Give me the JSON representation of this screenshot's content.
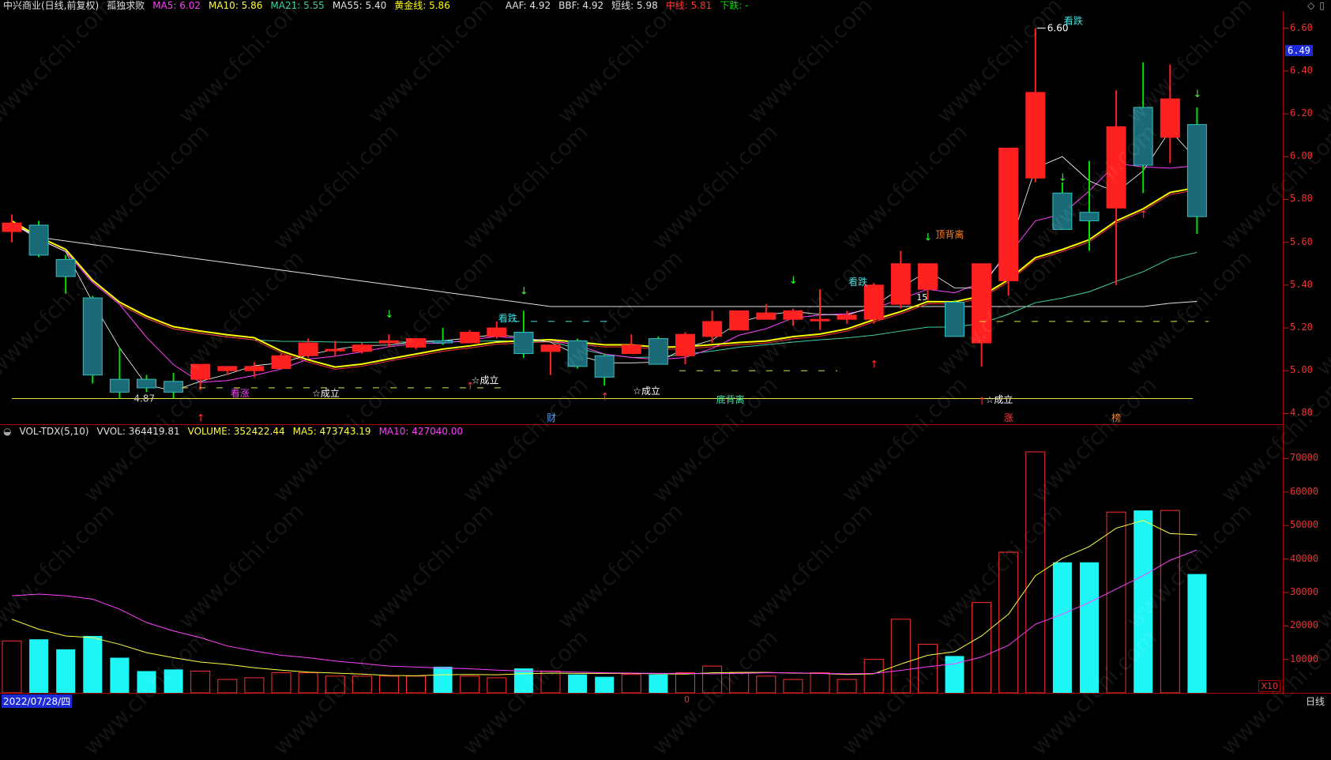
{
  "header": {
    "stock": "中兴商业(日线,前复权)",
    "strategy": "孤独求败",
    "items": [
      {
        "text": "MA5: 6.02",
        "color": "#ff40ff"
      },
      {
        "text": "MA10: 5.86",
        "color": "#ffff40"
      },
      {
        "text": "MA21: 5.55",
        "color": "#40d0a0"
      },
      {
        "text": "MA55: 5.40",
        "color": "#e0e0e0"
      },
      {
        "text": "黄金线: 5.86",
        "color": "#ffff00"
      },
      {
        "text": "AAF: 4.92",
        "color": "#e0e0e0"
      },
      {
        "text": "BBF: 4.92",
        "color": "#e0e0e0"
      },
      {
        "text": "短线: 5.98",
        "color": "#e0e0e0"
      },
      {
        "text": "中线: 5.81",
        "color": "#ff3030"
      },
      {
        "text": "下跌: -",
        "color": "#00e000"
      }
    ]
  },
  "corner_icons": [
    "diamond-icon",
    "window-icon"
  ],
  "price_axis": {
    "ticks": [
      "6.60",
      "6.40",
      "6.20",
      "6.00",
      "5.80",
      "5.60",
      "5.40",
      "5.20",
      "5.00",
      "4.80"
    ],
    "last_price": "6.49"
  },
  "vol_header": {
    "indicator": "VOL-TDX(5,10)",
    "vvol": "VVOL: 364419.81",
    "volume": "VOLUME: 352422.44",
    "ma5": "MA5: 473743.19",
    "ma10": "MA10: 427040.00"
  },
  "vol_axis": {
    "ticks": [
      "70000",
      "60000",
      "50000",
      "40000",
      "30000",
      "20000",
      "10000"
    ],
    "multiplier": "X10"
  },
  "annotations": {
    "high_label": "6.60",
    "low_label": "4.87",
    "kandie_1": "看跌",
    "kandie_2": "看跌",
    "kandie_3": "看跌",
    "kanzhang": "看涨",
    "chengli_1": "☆成立",
    "chengli_2": "☆成立",
    "chengli_3": "☆成立",
    "chengli_4": "☆成立",
    "dingbeili": "顶背离",
    "dibeili": "底背离",
    "cai": "财",
    "zhang": "涨",
    "bang": "榜",
    "mid_15": "15"
  },
  "footer": {
    "date": "2022/07/28/四",
    "period": "日线",
    "marker": "0"
  },
  "colors": {
    "up": "#ff2020",
    "down": "#00e000",
    "cyan": "#1ef5f5",
    "ma5": "#ff40ff",
    "ma10": "#ffff40",
    "ma21": "#40d0a0",
    "ma55": "#e0e0e0",
    "gold": "#ffff00",
    "teal_fill": "#1a6a78"
  },
  "watermark": "www.cfchi.com",
  "chart_data": {
    "type": "candlestick",
    "price_range": [
      4.75,
      6.68
    ],
    "candles": [
      {
        "o": 5.65,
        "h": 5.73,
        "l": 5.6,
        "c": 5.69
      },
      {
        "o": 5.68,
        "h": 5.7,
        "l": 5.53,
        "c": 5.54
      },
      {
        "o": 5.52,
        "h": 5.54,
        "l": 5.36,
        "c": 5.44
      },
      {
        "o": 5.34,
        "h": 5.35,
        "l": 4.94,
        "c": 4.98
      },
      {
        "o": 4.96,
        "h": 5.11,
        "l": 4.87,
        "c": 4.9
      },
      {
        "o": 4.96,
        "h": 4.98,
        "l": 4.9,
        "c": 4.92
      },
      {
        "o": 4.95,
        "h": 4.99,
        "l": 4.87,
        "c": 4.9
      },
      {
        "o": 4.96,
        "h": 5.03,
        "l": 4.91,
        "c": 5.03
      },
      {
        "o": 5.0,
        "h": 5.02,
        "l": 4.98,
        "c": 5.02
      },
      {
        "o": 5.0,
        "h": 5.04,
        "l": 4.97,
        "c": 5.02
      },
      {
        "o": 5.01,
        "h": 5.08,
        "l": 5.01,
        "c": 5.07
      },
      {
        "o": 5.07,
        "h": 5.15,
        "l": 5.06,
        "c": 5.13
      },
      {
        "o": 5.1,
        "h": 5.14,
        "l": 5.07,
        "c": 5.1
      },
      {
        "o": 5.09,
        "h": 5.13,
        "l": 5.08,
        "c": 5.12
      },
      {
        "o": 5.13,
        "h": 5.17,
        "l": 5.11,
        "c": 5.14
      },
      {
        "o": 5.11,
        "h": 5.15,
        "l": 5.1,
        "c": 5.15
      },
      {
        "o": 5.14,
        "h": 5.2,
        "l": 5.12,
        "c": 5.13
      },
      {
        "o": 5.13,
        "h": 5.19,
        "l": 5.13,
        "c": 5.18
      },
      {
        "o": 5.16,
        "h": 5.23,
        "l": 5.15,
        "c": 5.2
      },
      {
        "o": 5.18,
        "h": 5.28,
        "l": 5.06,
        "c": 5.08
      },
      {
        "o": 5.09,
        "h": 5.12,
        "l": 4.98,
        "c": 5.12
      },
      {
        "o": 5.14,
        "h": 5.15,
        "l": 5.01,
        "c": 5.02
      },
      {
        "o": 5.07,
        "h": 5.08,
        "l": 4.93,
        "c": 4.97
      },
      {
        "o": 5.08,
        "h": 5.17,
        "l": 5.08,
        "c": 5.12
      },
      {
        "o": 5.15,
        "h": 5.16,
        "l": 5.03,
        "c": 5.03
      },
      {
        "o": 5.07,
        "h": 5.18,
        "l": 5.03,
        "c": 5.17
      },
      {
        "o": 5.16,
        "h": 5.28,
        "l": 5.13,
        "c": 5.23
      },
      {
        "o": 5.19,
        "h": 5.28,
        "l": 5.19,
        "c": 5.28
      },
      {
        "o": 5.24,
        "h": 5.31,
        "l": 5.24,
        "c": 5.27
      },
      {
        "o": 5.24,
        "h": 5.29,
        "l": 5.21,
        "c": 5.28
      },
      {
        "o": 5.24,
        "h": 5.38,
        "l": 5.19,
        "c": 5.24
      },
      {
        "o": 5.24,
        "h": 5.28,
        "l": 5.22,
        "c": 5.26
      },
      {
        "o": 5.24,
        "h": 5.41,
        "l": 5.22,
        "c": 5.4
      },
      {
        "o": 5.31,
        "h": 5.56,
        "l": 5.29,
        "c": 5.5
      },
      {
        "o": 5.38,
        "h": 5.5,
        "l": 5.33,
        "c": 5.5
      },
      {
        "o": 5.32,
        "h": 5.33,
        "l": 5.16,
        "c": 5.16
      },
      {
        "o": 5.13,
        "h": 5.5,
        "l": 5.02,
        "c": 5.5
      },
      {
        "o": 5.42,
        "h": 6.04,
        "l": 5.35,
        "c": 6.04
      },
      {
        "o": 5.9,
        "h": 6.6,
        "l": 5.88,
        "c": 6.3
      },
      {
        "o": 5.83,
        "h": 5.88,
        "l": 5.66,
        "c": 5.66
      },
      {
        "o": 5.74,
        "h": 5.98,
        "l": 5.56,
        "c": 5.7
      },
      {
        "o": 5.76,
        "h": 6.31,
        "l": 5.4,
        "c": 6.14
      },
      {
        "o": 6.23,
        "h": 6.44,
        "l": 5.83,
        "c": 5.96
      },
      {
        "o": 6.09,
        "h": 6.43,
        "l": 5.97,
        "c": 6.27
      },
      {
        "o": 6.15,
        "h": 6.23,
        "l": 5.64,
        "c": 5.72
      }
    ],
    "volume": [
      15500,
      16000,
      13000,
      17000,
      10500,
      6500,
      7000,
      6500,
      4000,
      4500,
      6000,
      6000,
      5000,
      5000,
      5000,
      5000,
      7800,
      5000,
      4500,
      7300,
      6500,
      5500,
      4800,
      5500,
      5500,
      6000,
      8000,
      6000,
      5000,
      4000,
      6000,
      4000,
      10000,
      22000,
      14500,
      11000,
      27000,
      42000,
      72000,
      39000,
      39000,
      54000,
      54500,
      54500,
      35500
    ],
    "vol_ma5": [
      22000,
      19000,
      17000,
      16500,
      14500,
      12000,
      10500,
      9200,
      8500,
      7500,
      6800,
      6200,
      5900,
      5600,
      5200,
      5100,
      5400,
      5500,
      5400,
      5700,
      5900,
      5800,
      5800,
      5800,
      5700,
      5600,
      6000,
      6100,
      6100,
      5900,
      5800,
      5500,
      5700,
      8600,
      11200,
      12300,
      17000,
      23500,
      35000,
      40200,
      43700,
      49200,
      51500,
      47600,
      47200
    ],
    "vol_ma10": [
      29000,
      29500,
      29000,
      28000,
      25000,
      21000,
      18500,
      16500,
      14000,
      12500,
      11200,
      10500,
      9500,
      8800,
      8000,
      7700,
      7400,
      7200,
      6800,
      6500,
      6400,
      6200,
      6000,
      5900,
      5800,
      5800,
      5700,
      5800,
      6000,
      6000,
      5800,
      5700,
      5800,
      6700,
      7800,
      8700,
      10700,
      14200,
      20500,
      23500,
      27000,
      31000,
      35000,
      39600,
      42700
    ]
  }
}
